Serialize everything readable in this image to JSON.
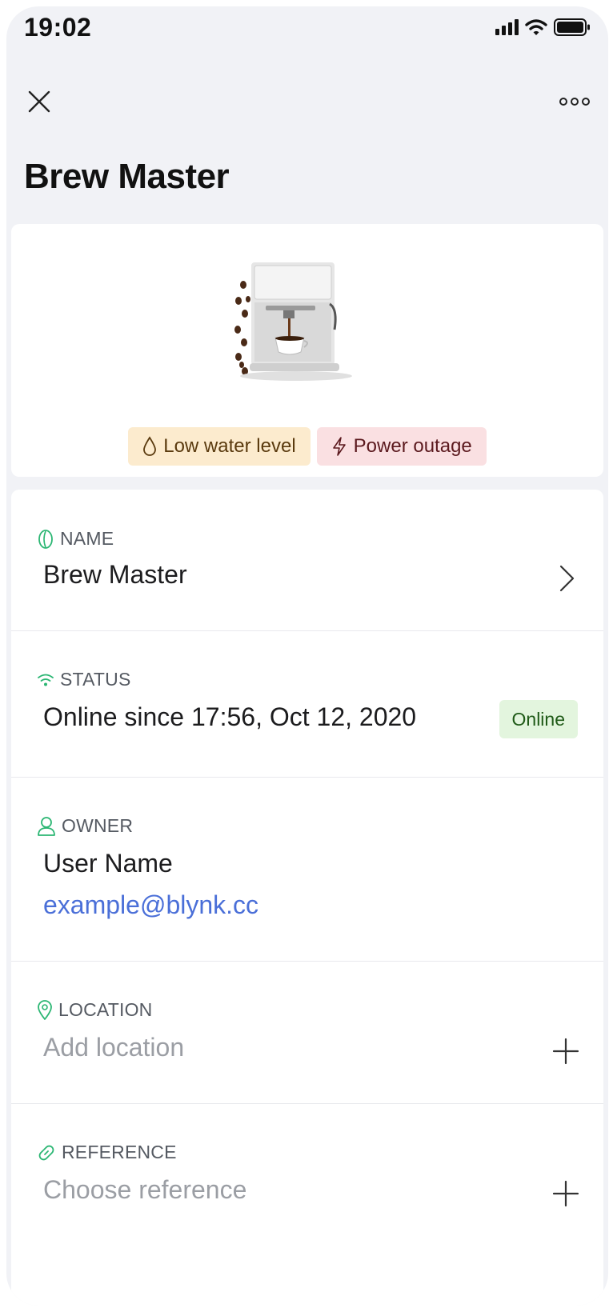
{
  "status_bar": {
    "time": "19:02",
    "icons": [
      "signal-icon",
      "wifi-icon",
      "battery-icon"
    ]
  },
  "header": {
    "close_icon": "close-icon",
    "more_icon": "more-icon",
    "title": "Brew Master"
  },
  "hero": {
    "image": "coffee-machine-image",
    "alerts": [
      {
        "icon": "water-drop-icon",
        "label": "Low water level",
        "color": "#fcebce"
      },
      {
        "icon": "lightning-icon",
        "label": "Power outage",
        "color": "#fae0e2"
      }
    ]
  },
  "details": {
    "name": {
      "label": "NAME",
      "value": "Brew Master",
      "icon": "coffee-bean-icon"
    },
    "status": {
      "label": "STATUS",
      "value": "Online since 17:56, Oct 12, 2020",
      "badge": "Online",
      "icon": "wifi-icon"
    },
    "owner": {
      "label": "OWNER",
      "name": "User Name",
      "email": "example@blynk.cc",
      "icon": "user-icon"
    },
    "location": {
      "label": "LOCATION",
      "placeholder": "Add location",
      "icon": "location-pin-icon"
    },
    "reference": {
      "label": "REFERENCE",
      "placeholder": "Choose reference",
      "icon": "link-icon"
    }
  },
  "colors": {
    "accent_green": "#2bb673",
    "link_blue": "#4a6fd8",
    "background": "#f1f2f6"
  }
}
